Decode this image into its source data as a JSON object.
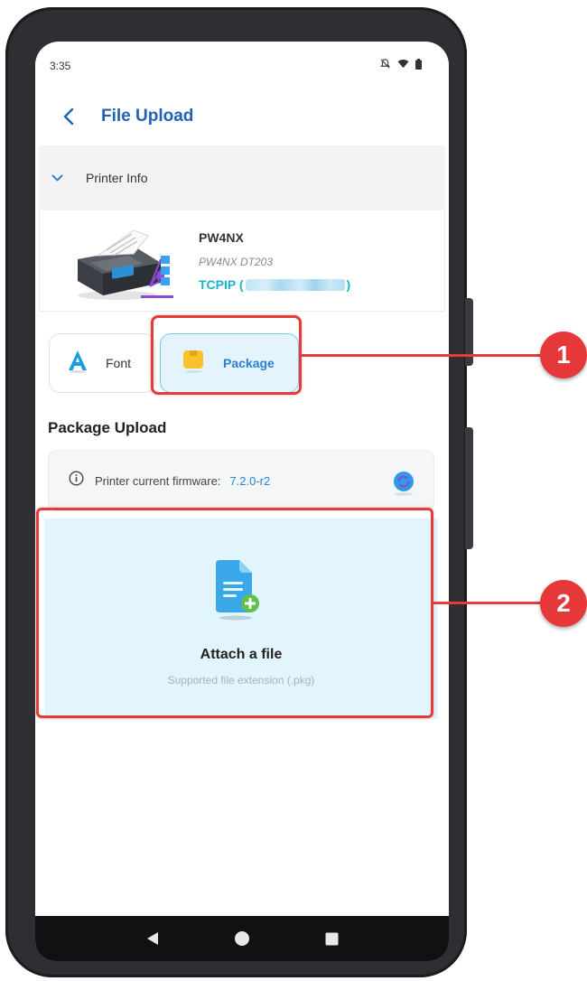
{
  "status_bar": {
    "time": "3:35",
    "icons": [
      "notifications-off-icon",
      "wifi-icon",
      "battery-icon"
    ]
  },
  "app_bar": {
    "title": "File Upload",
    "back_icon": "chevron-left-icon"
  },
  "printer_info": {
    "header_label": "Printer Info",
    "name": "PW4NX",
    "model": "PW4NX DT203",
    "connection_prefix": "TCPIP (",
    "connection_suffix": ")"
  },
  "tabs": [
    {
      "label": "Font",
      "icon": "font-a-icon",
      "selected": false
    },
    {
      "label": "Package",
      "icon": "package-icon",
      "selected": true
    }
  ],
  "package_upload": {
    "section_title": "Package Upload",
    "firmware_label": "Printer current firmware:",
    "firmware_value": "7.2.0-r2",
    "attach_title": "Attach a file",
    "attach_subtitle": "Supported file extension (.pkg)"
  },
  "callouts": {
    "one": "1",
    "two": "2"
  },
  "colors": {
    "accent": "#2b85d8",
    "title_blue": "#1e63b8",
    "teal": "#19b5c9",
    "callout_red": "#e53b3b",
    "attach_bg": "#e3f5fc"
  }
}
